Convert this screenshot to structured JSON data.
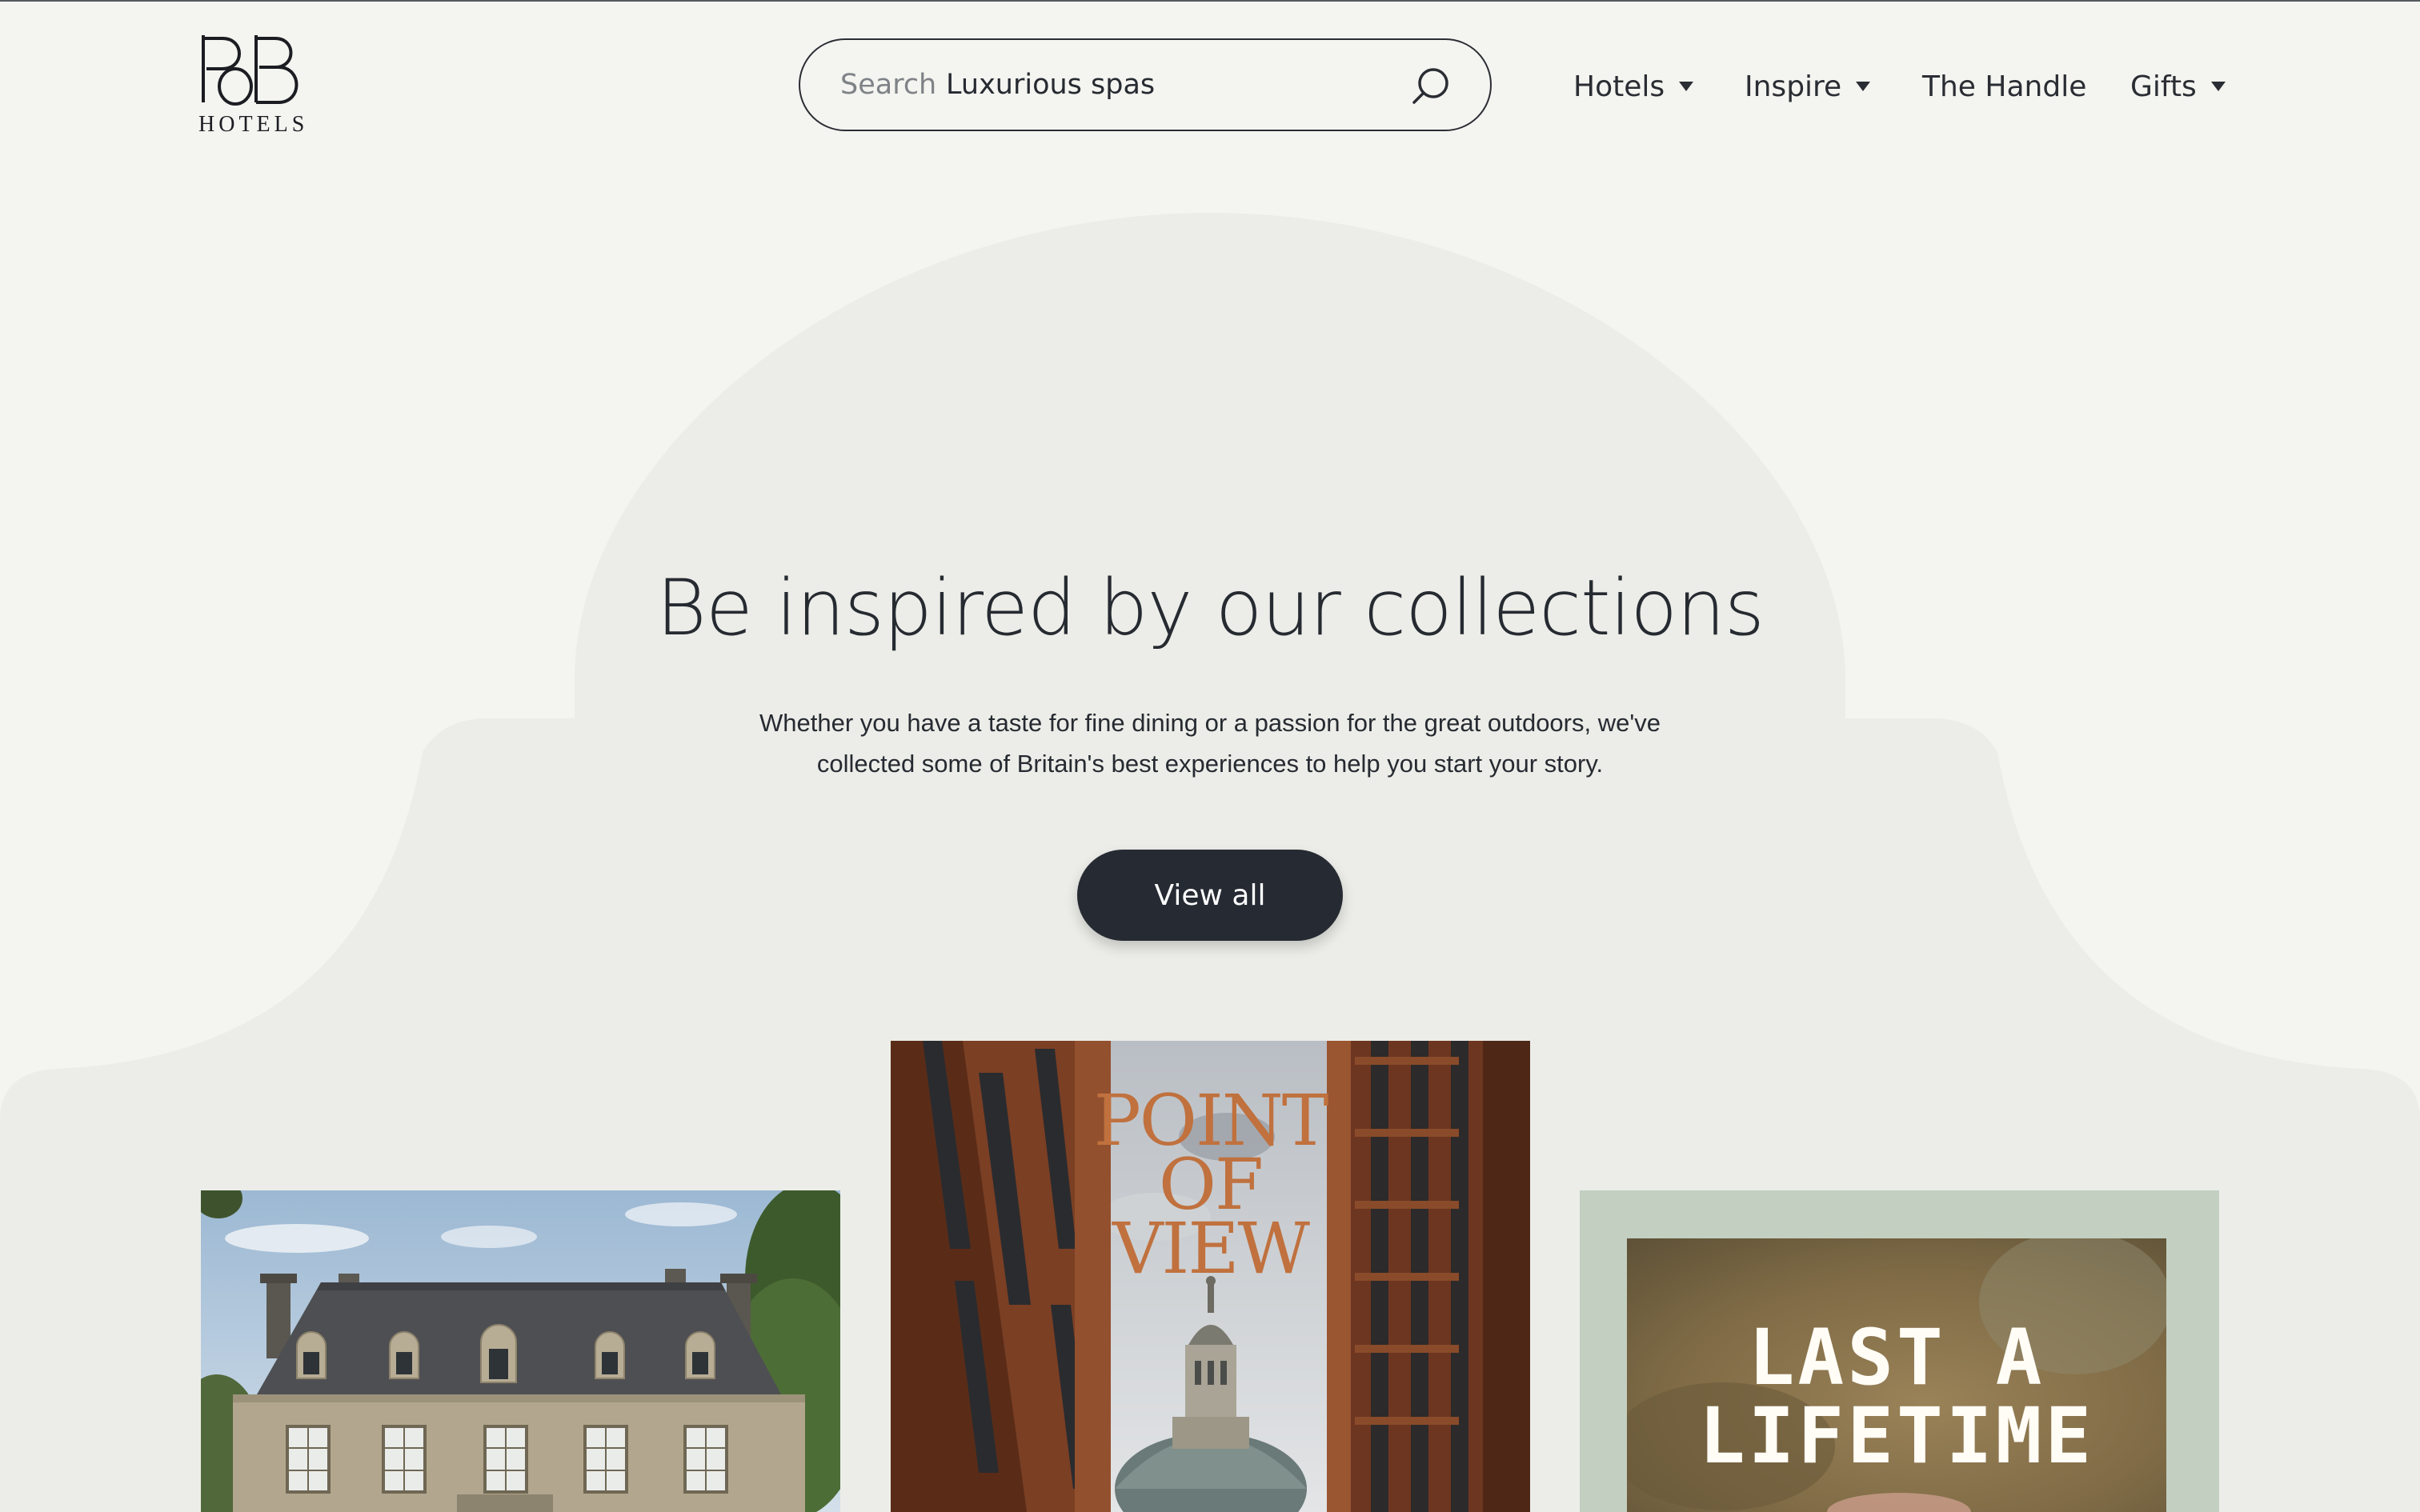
{
  "header": {
    "logo": {
      "mark": "PoB",
      "text": "HOTELS"
    },
    "search": {
      "label": "Search",
      "value": "Luxurious spas",
      "icon": "search-icon"
    },
    "nav": [
      {
        "label": "Hotels",
        "has_dropdown": true
      },
      {
        "label": "Inspire",
        "has_dropdown": true
      },
      {
        "label": "The Handle",
        "has_dropdown": false
      },
      {
        "label": "Gifts",
        "has_dropdown": true
      }
    ]
  },
  "hero": {
    "title": "Be inspired by our collections",
    "description": "Whether you have a taste for fine dining or a passion for the great outdoors, we've collected some of Britain's best experiences to help you start your story.",
    "button_label": "View all"
  },
  "cards": [
    {
      "image": "country-manor-house"
    },
    {
      "image": "point-of-view-cover",
      "overlay_lines": [
        "POINT",
        "OF",
        "VIEW"
      ]
    },
    {
      "image": "last-a-lifetime-cover",
      "overlay_lines": [
        "LAST A",
        "LIFETIME"
      ]
    }
  ],
  "colors": {
    "page_background": "#f4f4f0",
    "arch_background": "#ecede8",
    "button_background": "#262b33",
    "text": "#262a31",
    "pov_accent": "#c0713e",
    "card3_frame": "#c2cfc1"
  }
}
